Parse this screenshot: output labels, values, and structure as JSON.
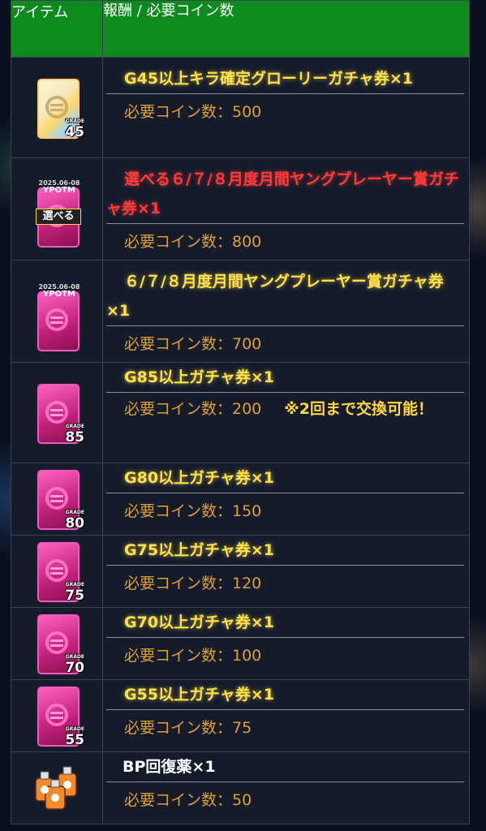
{
  "header": {
    "item_col": "アイテム",
    "reward_col": "報酬 / 必要コイン数"
  },
  "rows": [
    {
      "name": "G45以上キラ確定グローリーガチャ券×1",
      "cost": "必要コイン数：500",
      "grade": "45",
      "icon": "gold-ticket-icon"
    },
    {
      "name": "選べる６/７/８月度月間ヤングプレーヤー賞ガチャ券×1",
      "cost": "必要コイン数：800",
      "ticket_top": "2025.06-08",
      "ticket_title": "YPOTM",
      "ticket_badge": "選べる",
      "icon": "choose-ticket-icon"
    },
    {
      "name": "６/７/８月度月間ヤングプレーヤー賞ガチャ券×1",
      "cost": "必要コイン数：700",
      "ticket_top": "2025.06-08",
      "ticket_title": "YPOTM",
      "icon": "ypotm-ticket-icon"
    },
    {
      "name": "G85以上ガチャ券×1",
      "cost": "必要コイン数：200",
      "note": "※2回まで交換可能！",
      "grade": "85",
      "icon": "pink-ticket-icon"
    },
    {
      "name": "G80以上ガチャ券×1",
      "cost": "必要コイン数：150",
      "grade": "80",
      "icon": "pink-ticket-icon"
    },
    {
      "name": "G75以上ガチャ券×1",
      "cost": "必要コイン数：120",
      "grade": "75",
      "icon": "pink-ticket-icon"
    },
    {
      "name": "G70以上ガチャ券×1",
      "cost": "必要コイン数：100",
      "grade": "70",
      "icon": "pink-ticket-icon"
    },
    {
      "name": "G55以上ガチャ券×1",
      "cost": "必要コイン数：75",
      "grade": "55",
      "icon": "pink-ticket-icon"
    },
    {
      "name": "BP回復薬×1",
      "cost": "必要コイン数：50",
      "icon": "bp-potion-icon"
    }
  ],
  "grade_prefix": "GRADE",
  "colors": {
    "header_bg": "#0f8a1f",
    "name_gold": "#ffe24a",
    "name_red": "#ff3a3a",
    "cost": "#e0a030"
  }
}
